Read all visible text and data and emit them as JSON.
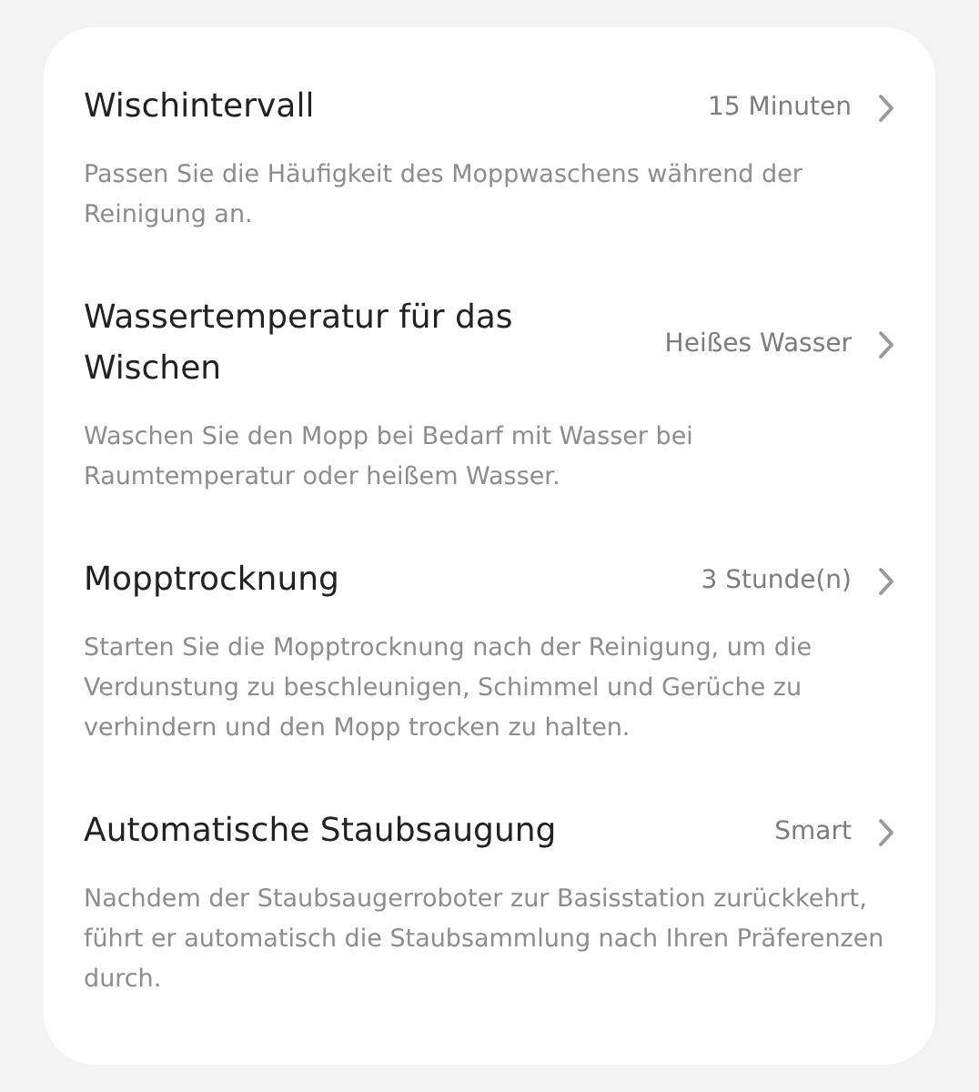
{
  "settings": [
    {
      "title": "Wischintervall",
      "value": "15 Minuten",
      "description": "Passen Sie die Häufigkeit des Moppwaschens während der Reinigung an."
    },
    {
      "title": "Wassertemperatur für das Wischen",
      "value": "Heißes Wasser",
      "description": "Waschen Sie den Mopp bei Bedarf mit Wasser bei Raumtemperatur oder heißem Wasser."
    },
    {
      "title": "Mopptrocknung",
      "value": "3 Stunde(n)",
      "description": "Starten Sie die Mopptrocknung nach der Reinigung, um die Verdunstung zu beschleunigen, Schimmel und Gerüche zu verhindern und den Mopp trocken zu halten."
    },
    {
      "title": "Automatische Staubsaugung",
      "value": "Smart",
      "description": "Nachdem der Staubsaugerroboter zur Basisstation zurückkehrt, führt er automatisch die Staubsammlung nach Ihren Präferenzen durch."
    }
  ]
}
